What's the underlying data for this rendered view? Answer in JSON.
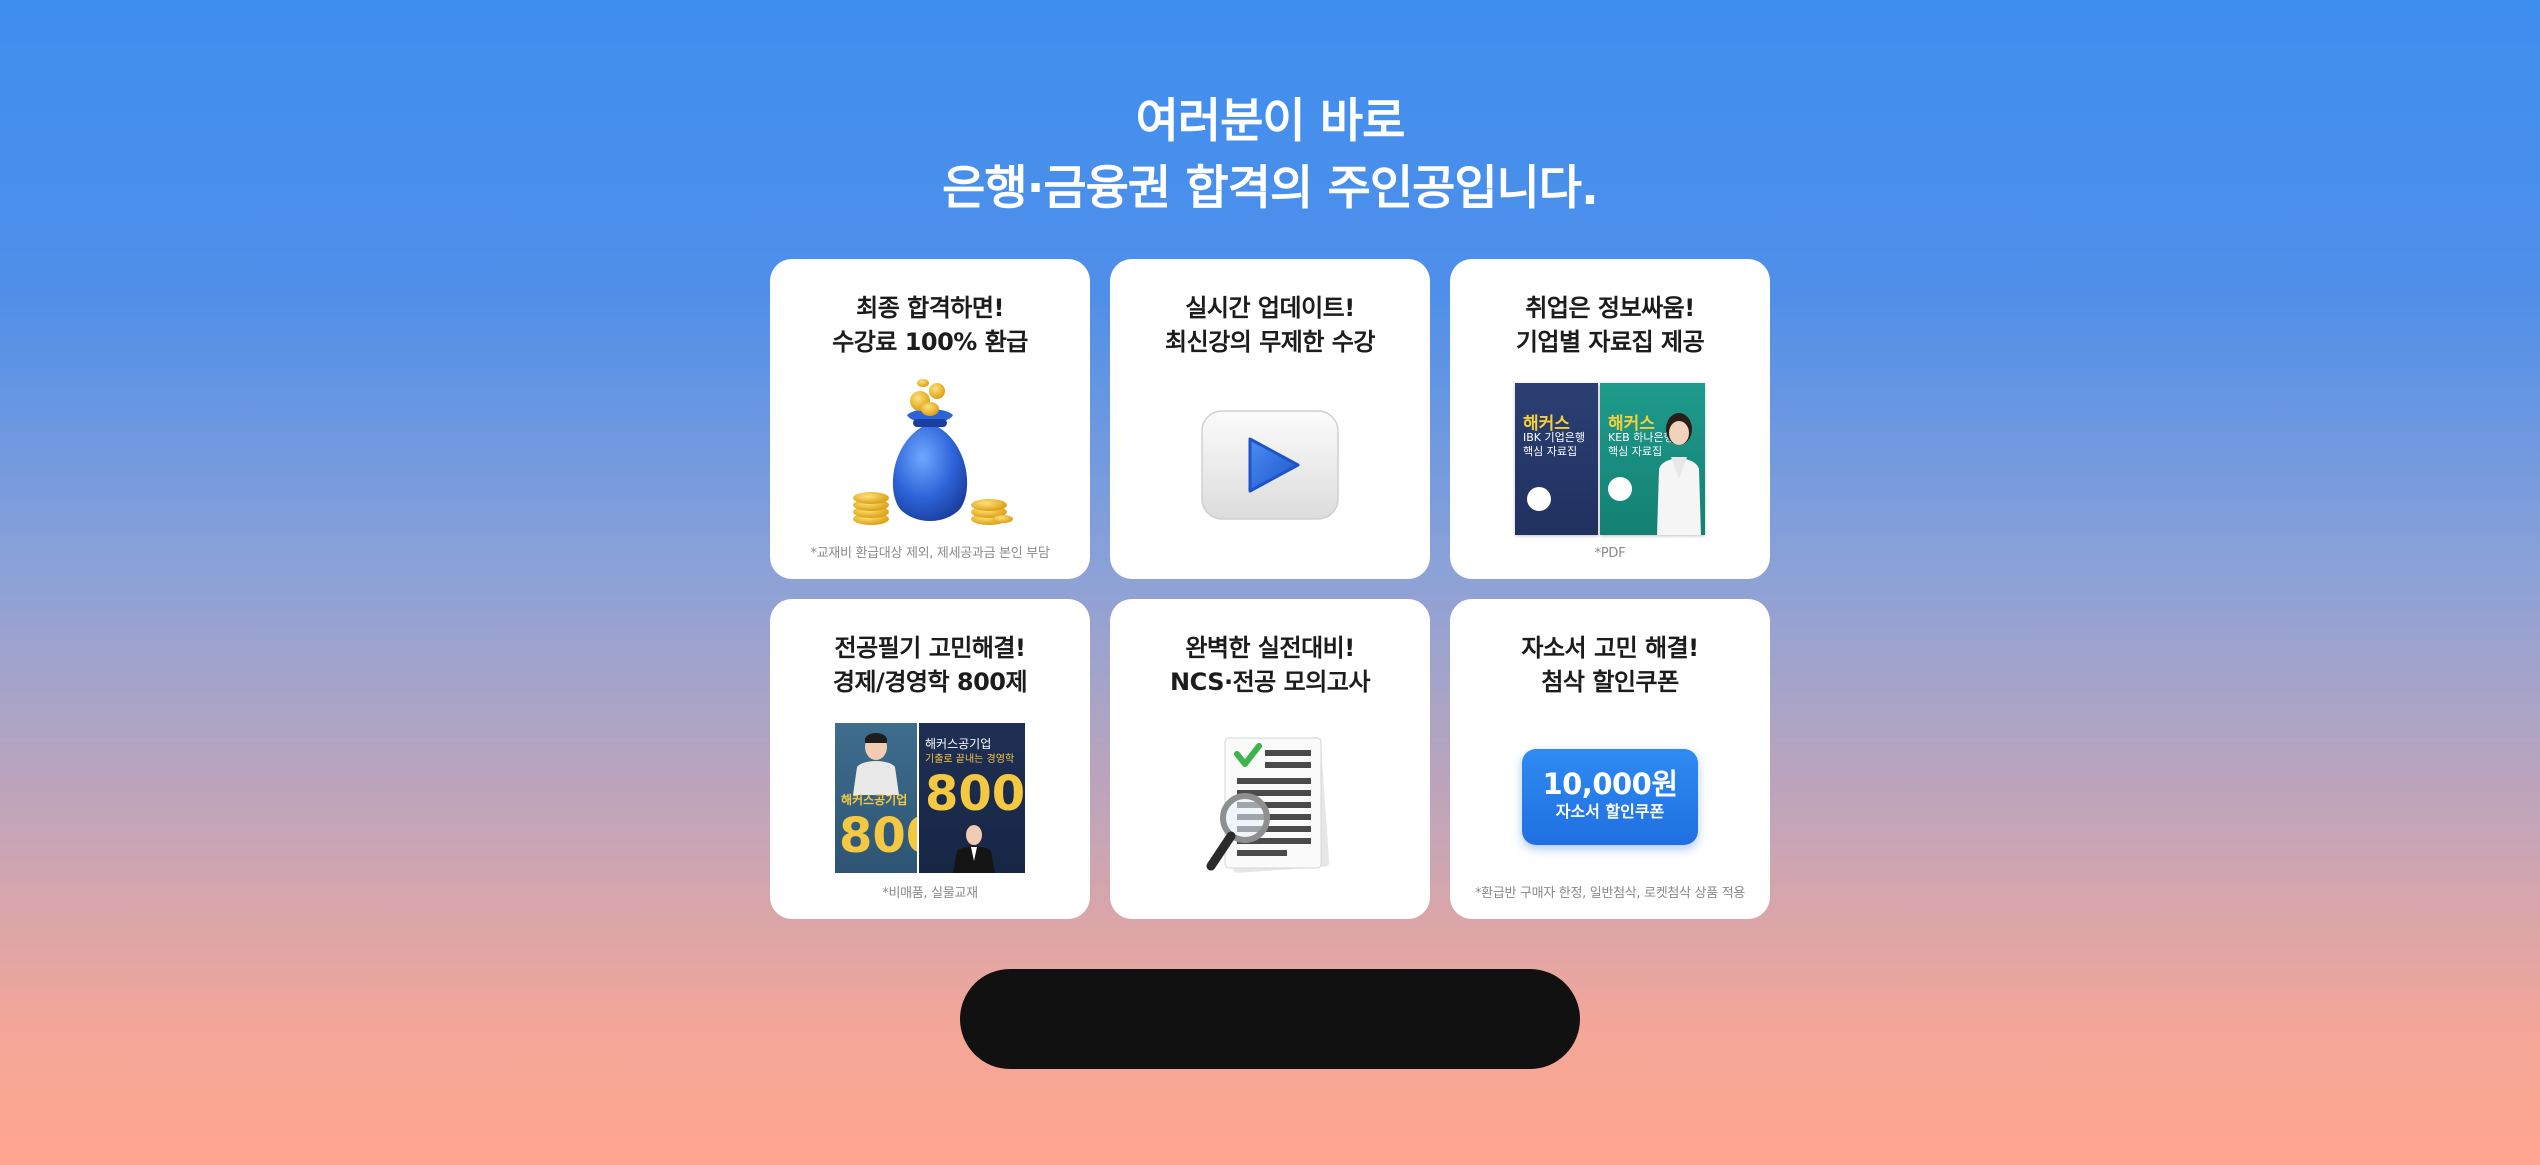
{
  "headline": {
    "line1": "여러분이 바로",
    "line2": "은행·금융권 합격의 주인공입니다."
  },
  "cards": [
    {
      "title_line1": "최종 합격하면!",
      "title_line2": "수강료 100% 환급",
      "note": "*교재비 환급대상 제외, 제세공과금 본인 부담",
      "icon": "money-bag-icon"
    },
    {
      "title_line1": "실시간 업데이트!",
      "title_line2": "최신강의 무제한 수강",
      "note": "",
      "icon": "play-button-icon"
    },
    {
      "title_line1": "취업은 정보싸움!",
      "title_line2": "기업별 자료집 제공",
      "note": "*PDF",
      "icon": "book-covers",
      "book1_brand": "해커스",
      "book1_sub1": "IBK 기업은행",
      "book1_sub2": "핵심 자료집",
      "book2_brand": "해커스",
      "book2_sub1": "KEB 하나은행",
      "book2_sub2": "핵심 자료집"
    },
    {
      "title_line1": "전공필기 고민해결!",
      "title_line2": "경제/경영학 800제",
      "note": "*비매품, 실물교재",
      "icon": "book-covers",
      "book1_brand": "해커스공기업",
      "book1_big": "800",
      "book2_brand": "해커스공기업",
      "book2_sub": "기출로 끝내는 경영학",
      "book2_big": "800"
    },
    {
      "title_line1": "완벽한 실전대비!",
      "title_line2": "NCS·전공 모의고사",
      "note": "",
      "icon": "document-magnifier-icon"
    },
    {
      "title_line1": "자소서 고민 해결!",
      "title_line2": "첨삭 할인쿠폰",
      "note": "*환급반 구매자 한정, 일반첨삭, 로켓첨삭 상품 적용",
      "icon": "coupon",
      "coupon_amount": "10,000원",
      "coupon_label": "자소서 할인쿠폰"
    }
  ],
  "cta_button": {
    "label": ""
  },
  "colors": {
    "gradient_top": "#3e8ff0",
    "gradient_bottom": "#ffa68f",
    "card_bg": "#ffffff",
    "coupon_blue": "#2a82ee",
    "cta_bg": "#111111"
  }
}
